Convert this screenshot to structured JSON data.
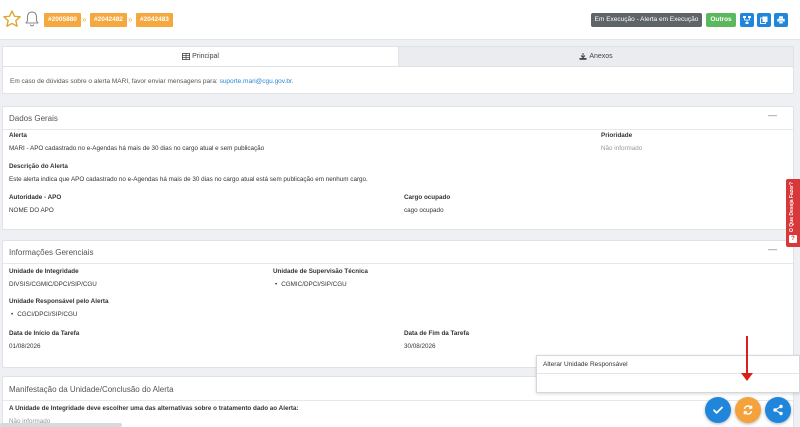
{
  "header": {
    "breadcrumbs": [
      "#2005880",
      "#2042482",
      "#2042483"
    ],
    "status_badge": "Em Execução - Alerta em Execução",
    "outros_label": "Outros",
    "colors": {
      "crumb": "#f4a83e",
      "status": "#5f6469",
      "outros": "#5cb85c",
      "action_blue": "#1f86dc"
    }
  },
  "tabs": [
    {
      "label": "Principal",
      "icon": "table-icon"
    },
    {
      "label": "Anexos",
      "icon": "download-icon"
    }
  ],
  "info": {
    "text": "Em caso de dúvidas sobre o alerta MARI, favor enviar mensagens para:",
    "email": "suporte.mari@cgu.gov.br."
  },
  "dados_gerais": {
    "title": "Dados Gerais",
    "alerta_label": "Alerta",
    "alerta_value": "MARI - APO cadastrado no e-Agendas há mais de 30 dias no cargo atual e sem publicação",
    "prioridade_label": "Prioridade",
    "prioridade_value": "Não informado",
    "descricao_label": "Descrição do Alerta",
    "descricao_value": "Este alerta indica que APO cadastrado no e-Agendas há mais de 30 dias no cargo atual está sem publicação em nenhum cargo.",
    "autoridade_label": "Autoridade - APO",
    "autoridade_value": "NOME DO APO",
    "cargo_label": "Cargo ocupado",
    "cargo_value": "cago ocupado"
  },
  "informacoes": {
    "title": "Informações Gerenciais",
    "integridade_label": "Unidade de Integridade",
    "integridade_value": "DIVSIS/CGMIC/DPCI/SIP/CGU",
    "supervisao_label": "Unidade de Supervisão Técnica",
    "supervisao_value": "CGMIC/DPCI/SIP/CGU",
    "responsavel_label": "Unidade Responsável pelo Alerta",
    "responsavel_value": "CGCI/DPCI/SIP/CGU",
    "inicio_label": "Data de Início da Tarefa",
    "inicio_value": "01/08/2026",
    "fim_label": "Data de Fim da Tarefa",
    "fim_value": "30/08/2026"
  },
  "manifestacao": {
    "title": "Manifestação da Unidade/Conclusão do Alerta",
    "pergunta": "A Unidade de Integridade deve escolher uma das alternativas sobre o tratamento dado ao Alerta:",
    "resposta": "Não informado"
  },
  "side_tab": {
    "label": "O Que Deseja Fazer?",
    "icon": "question-icon",
    "color": "#d9383a"
  },
  "popup": {
    "label": "Alterar Unidade Responsável"
  },
  "fabs": [
    {
      "name": "check-icon",
      "color": "#1f86dc"
    },
    {
      "name": "exchange-icon",
      "color": "#f4a23c"
    },
    {
      "name": "share-icon",
      "color": "#1f86dc"
    }
  ],
  "annotation": {
    "arrow_color": "#d8201b"
  }
}
